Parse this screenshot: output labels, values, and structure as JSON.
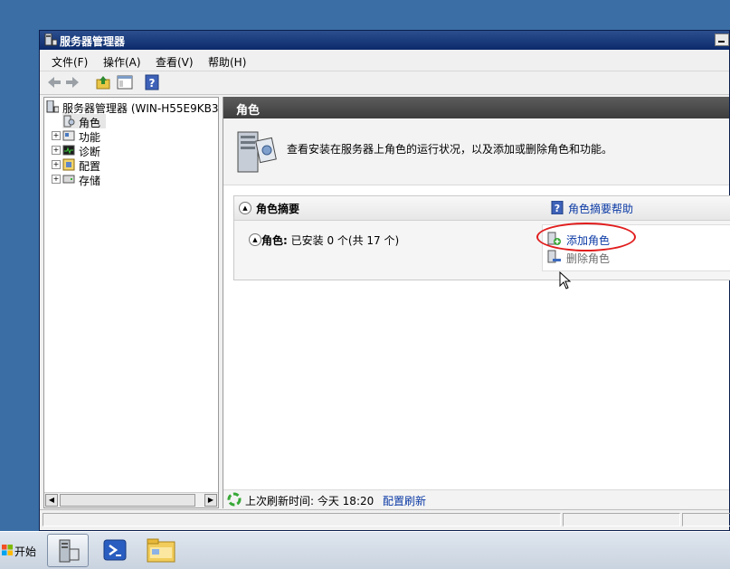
{
  "window": {
    "title": "服务器管理器"
  },
  "menu": {
    "items": [
      "文件(F)",
      "操作(A)",
      "查看(V)",
      "帮助(H)"
    ]
  },
  "tree": {
    "root": "服务器管理器 (WIN-H55E9KB39J",
    "items": [
      {
        "label": "角色",
        "selected": true,
        "expandable": false
      },
      {
        "label": "功能",
        "selected": false,
        "expandable": true
      },
      {
        "label": "诊断",
        "selected": false,
        "expandable": true
      },
      {
        "label": "配置",
        "selected": false,
        "expandable": true
      },
      {
        "label": "存储",
        "selected": false,
        "expandable": true
      }
    ]
  },
  "right_pane": {
    "header": "角色",
    "intro": "查看安装在服务器上角色的运行状况，以及添加或删除角色和功能。",
    "section_title": "角色摘要",
    "help_link": "角色摘要帮助",
    "roles_label": "角色:",
    "roles_status": "已安装 0 个(共 17 个)",
    "add_roles": "添加角色",
    "remove_roles": "删除角色",
    "last_refresh": "上次刷新时间: 今天 18:20",
    "config_refresh": "配置刷新"
  },
  "taskbar": {
    "start_label": "开始",
    "apps": [
      "server-manager-icon",
      "powershell-icon",
      "explorer-icon"
    ]
  },
  "colors": {
    "desktop": "#3a6ea5",
    "title_bar": "#0b2a6b",
    "link": "#0b3aa5",
    "highlight": "#e11d1d"
  }
}
